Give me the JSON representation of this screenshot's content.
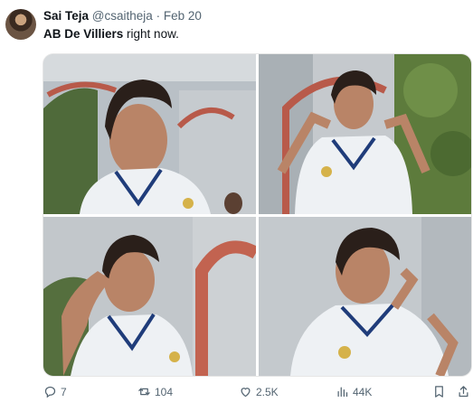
{
  "tweet": {
    "author_name": "Sai Teja",
    "author_handle": "@csaitheja",
    "separator": "·",
    "date": "Feb 20",
    "text_highlight": "AB De Villiers",
    "text_rest": " right now."
  },
  "actions": {
    "replies": "7",
    "retweets": "104",
    "likes": "2.5K",
    "views": "44K"
  },
  "icons": {
    "reply": "reply-icon",
    "retweet": "retweet-icon",
    "like": "heart-icon",
    "views": "views-icon",
    "bookmark": "bookmark-icon",
    "share": "share-icon"
  },
  "colors": {
    "text_primary": "#0f1419",
    "text_secondary": "#536471"
  }
}
